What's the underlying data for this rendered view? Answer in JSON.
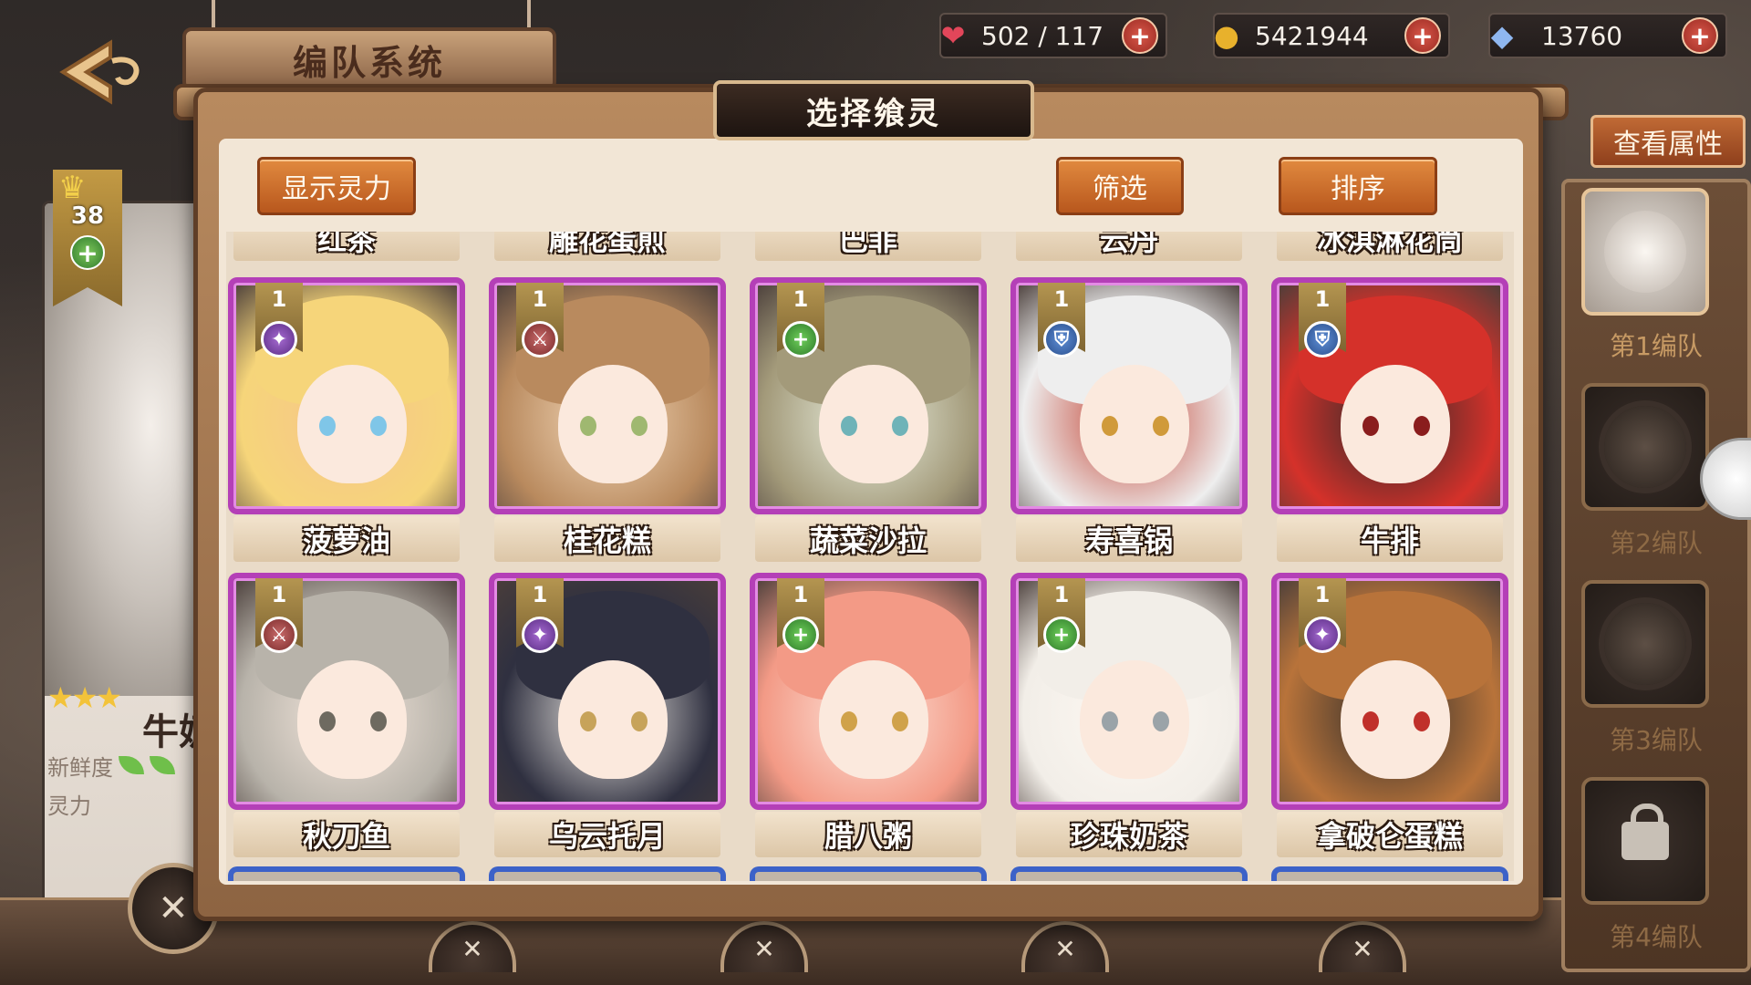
{
  "header": {
    "title": "编队系统",
    "resources": [
      {
        "name": "stamina",
        "icon": "heart-icon",
        "value": "502 / 117"
      },
      {
        "name": "gold",
        "icon": "coin-icon",
        "value": "5421944"
      },
      {
        "name": "diamond",
        "icon": "crystal-icon",
        "value": "13760"
      }
    ]
  },
  "modal": {
    "title": "选择飨灵",
    "show_power_label": "显示灵力",
    "filter_label": "筛选",
    "sort_label": "排序",
    "partial_top_names": [
      "红茶",
      "雕花蛋煎",
      "巴菲",
      "云丹",
      "冰淇淋花筒"
    ],
    "cards": [
      {
        "name": "菠萝油",
        "level": "1",
        "role": "star",
        "palette": [
          "#f6d57a",
          "#7fc6e8",
          "#f7c58a"
        ]
      },
      {
        "name": "桂花糕",
        "level": "1",
        "role": "sword",
        "palette": [
          "#b98a5e",
          "#9fb870",
          "#f2d7b8"
        ]
      },
      {
        "name": "蔬菜沙拉",
        "level": "1",
        "role": "heal",
        "palette": [
          "#a39a7a",
          "#6fb3b8",
          "#eaf0e0"
        ]
      },
      {
        "name": "寿喜锅",
        "level": "1",
        "role": "shield",
        "palette": [
          "#eeeeee",
          "#d09a3a",
          "#c03a2a"
        ]
      },
      {
        "name": "牛排",
        "level": "1",
        "role": "shield",
        "palette": [
          "#d5312a",
          "#8a1d1d",
          "#2a2a2a"
        ]
      },
      {
        "name": "秋刀鱼",
        "level": "1",
        "role": "sword",
        "palette": [
          "#b8b3aa",
          "#6e6a60",
          "#f3e6dc"
        ]
      },
      {
        "name": "乌云托月",
        "level": "1",
        "role": "star",
        "palette": [
          "#2f3040",
          "#c7a35a",
          "#f0ece6"
        ]
      },
      {
        "name": "腊八粥",
        "level": "1",
        "role": "heal",
        "palette": [
          "#f39a86",
          "#d0a24a",
          "#fde4da"
        ]
      },
      {
        "name": "珍珠奶茶",
        "level": "1",
        "role": "heal",
        "palette": [
          "#f2eee8",
          "#9aa3a8",
          "#fdf8f2"
        ]
      },
      {
        "name": "拿破仑蛋糕",
        "level": "1",
        "role": "star",
        "palette": [
          "#b8733a",
          "#c0302a",
          "#2b2b2b"
        ]
      }
    ]
  },
  "selected_character": {
    "name": "牛奶",
    "level": "38",
    "stars": "★★★",
    "freshness_label": "新鲜度",
    "power_label": "灵力"
  },
  "team_panel": {
    "view_attributes_label": "查看属性",
    "teams": [
      "第1编队",
      "第2编队",
      "第3编队",
      "第4编队"
    ]
  },
  "colors": {
    "accent_orange": "#c9652a",
    "card_border_purple": "#b43fb7",
    "panel_brown": "#8d6442"
  }
}
